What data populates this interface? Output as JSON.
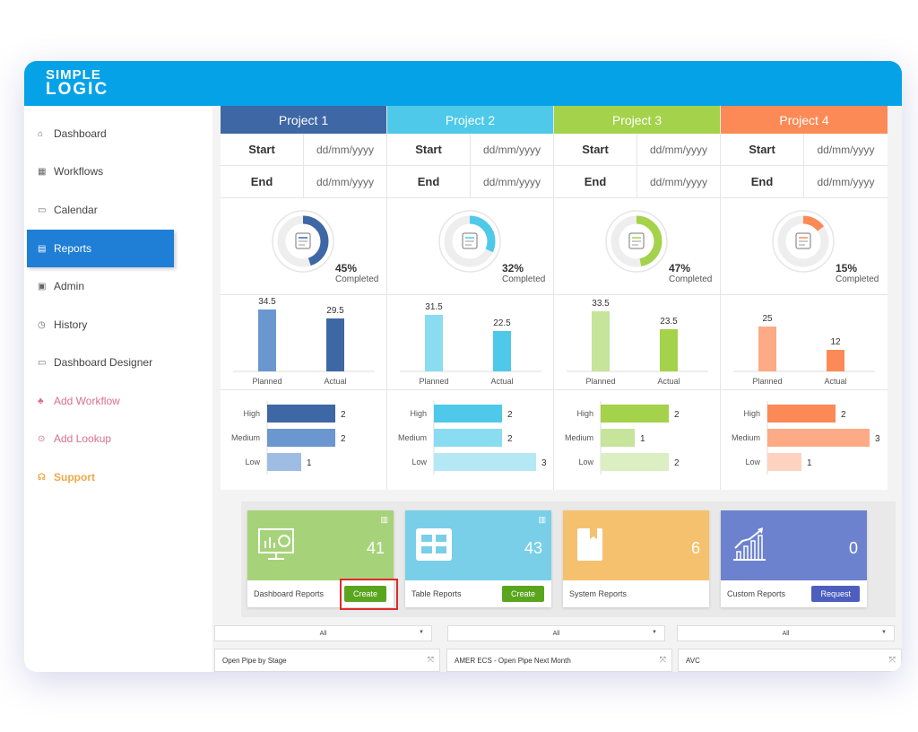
{
  "app": {
    "logo_line1": "SIMPLE",
    "logo_line2": "LOGIC"
  },
  "sidebar": {
    "items": [
      {
        "label": "Dashboard",
        "icon": "home-icon"
      },
      {
        "label": "Workflows",
        "icon": "grid-icon"
      },
      {
        "label": "Calendar",
        "icon": "calendar-icon"
      },
      {
        "label": "Reports",
        "icon": "reports-icon",
        "active": true
      },
      {
        "label": "Admin",
        "icon": "admin-icon"
      },
      {
        "label": "History",
        "icon": "history-icon"
      },
      {
        "label": "Dashboard Designer",
        "icon": "designer-icon"
      },
      {
        "label": "Add Workflow",
        "icon": "workflow-add-icon"
      },
      {
        "label": "Add Lookup",
        "icon": "lookup-icon"
      },
      {
        "label": "Support",
        "icon": "headset-icon"
      }
    ]
  },
  "projects": [
    {
      "name": "Project 1",
      "color": "#3e67a5",
      "start_label": "Start",
      "start_value": "dd/mm/yyyy",
      "end_label": "End",
      "end_value": "dd/mm/yyyy",
      "percent": "45%",
      "percent_value": 45,
      "completed_label": "Completed",
      "planned": "34.5",
      "actual": "29.5",
      "planned_value": 34.5,
      "actual_value": 29.5,
      "planned_color": "#6b97d0",
      "actual_color": "#3e67a5",
      "high": 2,
      "medium": 2,
      "low": 1,
      "high_color": "#3e67a5",
      "medium_color": "#6b97d0",
      "low_color": "#9fbce3"
    },
    {
      "name": "Project 2",
      "color": "#4ec9e9",
      "start_label": "Start",
      "start_value": "dd/mm/yyyy",
      "end_label": "End",
      "end_value": "dd/mm/yyyy",
      "percent": "32%",
      "percent_value": 32,
      "completed_label": "Completed",
      "planned": "31.5",
      "actual": "22.5",
      "planned_value": 31.5,
      "actual_value": 22.5,
      "planned_color": "#8adcf0",
      "actual_color": "#4ec9e9",
      "high": 2,
      "medium": 2,
      "low": 3,
      "high_color": "#4ec9e9",
      "medium_color": "#8adcf0",
      "low_color": "#b4e8f5"
    },
    {
      "name": "Project 3",
      "color": "#a4d24a",
      "start_label": "Start",
      "start_value": "dd/mm/yyyy",
      "end_label": "End",
      "end_value": "dd/mm/yyyy",
      "percent": "47%",
      "percent_value": 47,
      "completed_label": "Completed",
      "planned": "33.5",
      "actual": "23.5",
      "planned_value": 33.5,
      "actual_value": 23.5,
      "planned_color": "#c6e49a",
      "actual_color": "#a4d24a",
      "high": 2,
      "medium": 1,
      "low": 2,
      "high_color": "#a4d24a",
      "medium_color": "#c6e49a",
      "low_color": "#dcefc3"
    },
    {
      "name": "Project 4",
      "color": "#fc8a56",
      "start_label": "Start",
      "start_value": "dd/mm/yyyy",
      "end_label": "End",
      "end_value": "dd/mm/yyyy",
      "percent": "15%",
      "percent_value": 15,
      "completed_label": "Completed",
      "planned": "25",
      "actual": "12",
      "planned_value": 25,
      "actual_value": 12,
      "planned_color": "#fdaa86",
      "actual_color": "#fc8a56",
      "high": 2,
      "medium": 3,
      "low": 1,
      "high_color": "#fc8a56",
      "medium_color": "#fdaa86",
      "low_color": "#fdd3c0"
    }
  ],
  "chart_labels": {
    "planned": "Planned",
    "actual": "Actual",
    "high": "High",
    "medium": "Medium",
    "low": "Low"
  },
  "cards": [
    {
      "title": "Dashboard Reports",
      "count": "41",
      "color": "#a6d37a",
      "button": "Create",
      "button_style": "green",
      "icon": "monitor-chart-icon"
    },
    {
      "title": "Table Reports",
      "count": "43",
      "color": "#79cfe8",
      "button": "Create",
      "button_style": "green",
      "icon": "table-icon"
    },
    {
      "title": "System Reports",
      "count": "6",
      "color": "#f6c16f",
      "button": "",
      "button_style": "",
      "icon": "book-icon"
    },
    {
      "title": "Custom Reports",
      "count": "0",
      "color": "#6c82cf",
      "button": "Request",
      "button_style": "blue",
      "icon": "growth-chart-icon"
    }
  ],
  "filters": [
    "All",
    "All",
    "All"
  ],
  "panels": [
    "Open Pipe by Stage",
    "AMER ECS - Open Pipe Next Month",
    "AVC"
  ]
}
